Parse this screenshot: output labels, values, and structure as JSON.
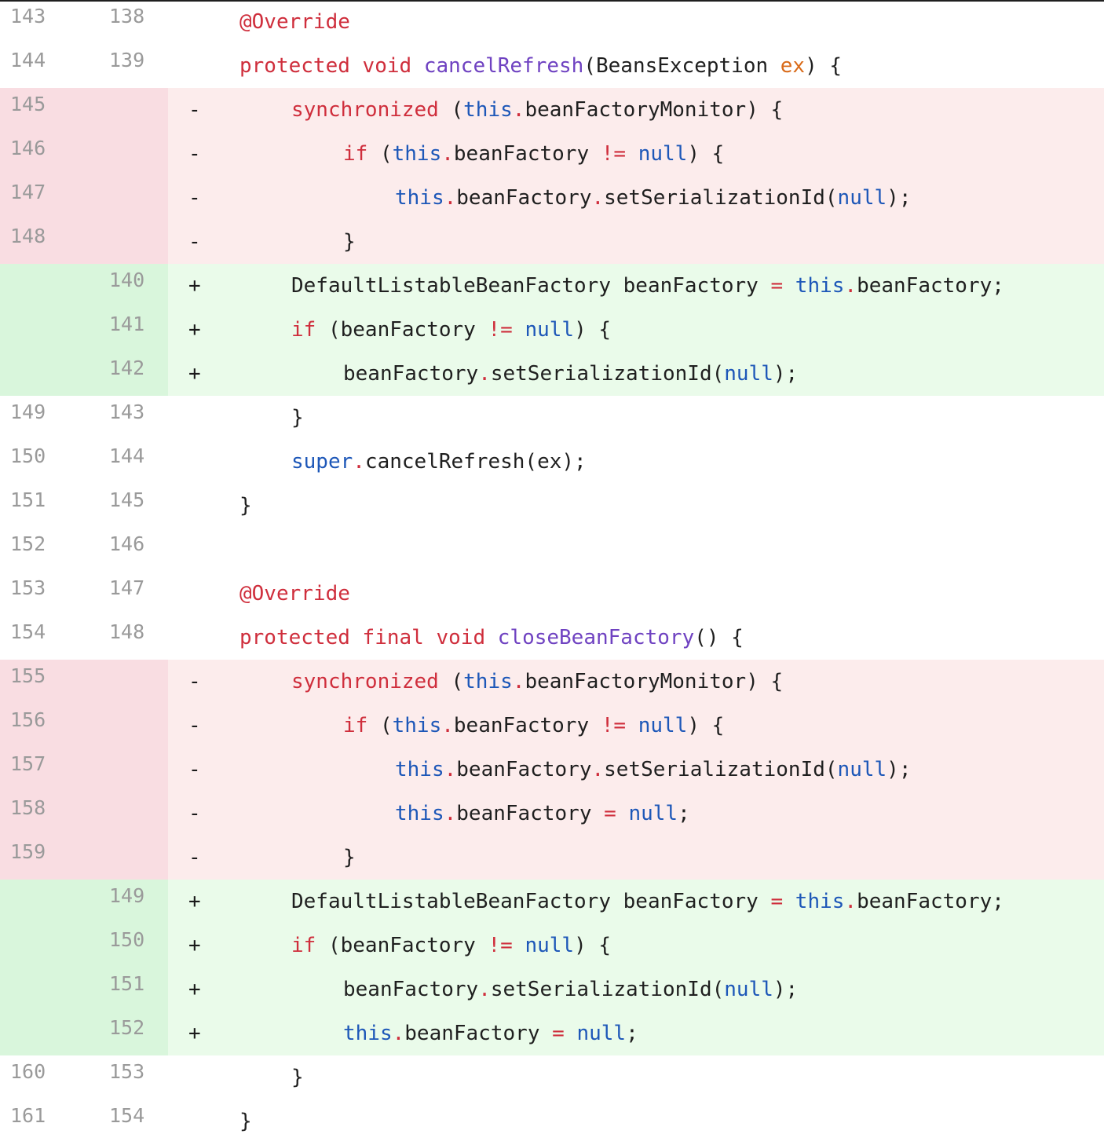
{
  "diff": {
    "lines": [
      {
        "type": "context",
        "old": "143",
        "new": "138",
        "marker": "",
        "indent": 1,
        "tokens": [
          {
            "t": "@Override",
            "c": "ann"
          }
        ]
      },
      {
        "type": "context",
        "old": "144",
        "new": "139",
        "marker": "",
        "indent": 1,
        "tokens": [
          {
            "t": "protected",
            "c": "kw"
          },
          {
            "t": " "
          },
          {
            "t": "void",
            "c": "kw"
          },
          {
            "t": " "
          },
          {
            "t": "cancelRefresh",
            "c": "fn"
          },
          {
            "t": "(BeansException "
          },
          {
            "t": "ex",
            "c": "par"
          },
          {
            "t": ") {"
          }
        ]
      },
      {
        "type": "removed",
        "old": "145",
        "new": "",
        "marker": "-",
        "indent": 2,
        "tokens": [
          {
            "t": "synchronized",
            "c": "kw"
          },
          {
            "t": " ("
          },
          {
            "t": "this",
            "c": "lit"
          },
          {
            "t": ".",
            "c": "op"
          },
          {
            "t": "beanFactoryMonitor) {"
          }
        ]
      },
      {
        "type": "removed",
        "old": "146",
        "new": "",
        "marker": "-",
        "indent": 3,
        "tokens": [
          {
            "t": "if",
            "c": "kw"
          },
          {
            "t": " ("
          },
          {
            "t": "this",
            "c": "lit"
          },
          {
            "t": ".",
            "c": "op"
          },
          {
            "t": "beanFactory "
          },
          {
            "t": "!=",
            "c": "op"
          },
          {
            "t": " "
          },
          {
            "t": "null",
            "c": "lit"
          },
          {
            "t": ") {"
          }
        ]
      },
      {
        "type": "removed",
        "old": "147",
        "new": "",
        "marker": "-",
        "indent": 4,
        "tokens": [
          {
            "t": "this",
            "c": "lit"
          },
          {
            "t": ".",
            "c": "op"
          },
          {
            "t": "beanFactory"
          },
          {
            "t": ".",
            "c": "op"
          },
          {
            "t": "setSerializationId("
          },
          {
            "t": "null",
            "c": "lit"
          },
          {
            "t": ");"
          }
        ]
      },
      {
        "type": "removed",
        "old": "148",
        "new": "",
        "marker": "-",
        "indent": 3,
        "tokens": [
          {
            "t": "}"
          }
        ]
      },
      {
        "type": "added",
        "old": "",
        "new": "140",
        "marker": "+",
        "indent": 2,
        "tokens": [
          {
            "t": "DefaultListableBeanFactory beanFactory "
          },
          {
            "t": "=",
            "c": "op"
          },
          {
            "t": " "
          },
          {
            "t": "this",
            "c": "lit"
          },
          {
            "t": ".",
            "c": "op"
          },
          {
            "t": "beanFactory;"
          }
        ]
      },
      {
        "type": "added",
        "old": "",
        "new": "141",
        "marker": "+",
        "indent": 2,
        "tokens": [
          {
            "t": "if",
            "c": "kw"
          },
          {
            "t": " (beanFactory "
          },
          {
            "t": "!=",
            "c": "op"
          },
          {
            "t": " "
          },
          {
            "t": "null",
            "c": "lit"
          },
          {
            "t": ") {"
          }
        ]
      },
      {
        "type": "added",
        "old": "",
        "new": "142",
        "marker": "+",
        "indent": 3,
        "tokens": [
          {
            "t": "beanFactory"
          },
          {
            "t": ".",
            "c": "op"
          },
          {
            "t": "setSerializationId("
          },
          {
            "t": "null",
            "c": "lit"
          },
          {
            "t": ");"
          }
        ]
      },
      {
        "type": "context",
        "old": "149",
        "new": "143",
        "marker": "",
        "indent": 2,
        "tokens": [
          {
            "t": "}"
          }
        ]
      },
      {
        "type": "context",
        "old": "150",
        "new": "144",
        "marker": "",
        "indent": 2,
        "tokens": [
          {
            "t": "super",
            "c": "lit"
          },
          {
            "t": ".",
            "c": "op"
          },
          {
            "t": "cancelRefresh(ex);"
          }
        ]
      },
      {
        "type": "context",
        "old": "151",
        "new": "145",
        "marker": "",
        "indent": 1,
        "tokens": [
          {
            "t": "}"
          }
        ]
      },
      {
        "type": "context",
        "old": "152",
        "new": "146",
        "marker": "",
        "indent": 1,
        "tokens": []
      },
      {
        "type": "context",
        "old": "153",
        "new": "147",
        "marker": "",
        "indent": 1,
        "tokens": [
          {
            "t": "@Override",
            "c": "ann"
          }
        ]
      },
      {
        "type": "context",
        "old": "154",
        "new": "148",
        "marker": "",
        "indent": 1,
        "tokens": [
          {
            "t": "protected",
            "c": "kw"
          },
          {
            "t": " "
          },
          {
            "t": "final",
            "c": "kw"
          },
          {
            "t": " "
          },
          {
            "t": "void",
            "c": "kw"
          },
          {
            "t": " "
          },
          {
            "t": "closeBeanFactory",
            "c": "fn"
          },
          {
            "t": "() {"
          }
        ]
      },
      {
        "type": "removed",
        "old": "155",
        "new": "",
        "marker": "-",
        "indent": 2,
        "tokens": [
          {
            "t": "synchronized",
            "c": "kw"
          },
          {
            "t": " ("
          },
          {
            "t": "this",
            "c": "lit"
          },
          {
            "t": ".",
            "c": "op"
          },
          {
            "t": "beanFactoryMonitor) {"
          }
        ]
      },
      {
        "type": "removed",
        "old": "156",
        "new": "",
        "marker": "-",
        "indent": 3,
        "tokens": [
          {
            "t": "if",
            "c": "kw"
          },
          {
            "t": " ("
          },
          {
            "t": "this",
            "c": "lit"
          },
          {
            "t": ".",
            "c": "op"
          },
          {
            "t": "beanFactory "
          },
          {
            "t": "!=",
            "c": "op"
          },
          {
            "t": " "
          },
          {
            "t": "null",
            "c": "lit"
          },
          {
            "t": ") {"
          }
        ]
      },
      {
        "type": "removed",
        "old": "157",
        "new": "",
        "marker": "-",
        "indent": 4,
        "tokens": [
          {
            "t": "this",
            "c": "lit"
          },
          {
            "t": ".",
            "c": "op"
          },
          {
            "t": "beanFactory"
          },
          {
            "t": ".",
            "c": "op"
          },
          {
            "t": "setSerializationId("
          },
          {
            "t": "null",
            "c": "lit"
          },
          {
            "t": ");"
          }
        ]
      },
      {
        "type": "removed",
        "old": "158",
        "new": "",
        "marker": "-",
        "indent": 4,
        "tokens": [
          {
            "t": "this",
            "c": "lit"
          },
          {
            "t": ".",
            "c": "op"
          },
          {
            "t": "beanFactory "
          },
          {
            "t": "=",
            "c": "op"
          },
          {
            "t": " "
          },
          {
            "t": "null",
            "c": "lit"
          },
          {
            "t": ";"
          }
        ]
      },
      {
        "type": "removed",
        "old": "159",
        "new": "",
        "marker": "-",
        "indent": 3,
        "tokens": [
          {
            "t": "}"
          }
        ]
      },
      {
        "type": "added",
        "old": "",
        "new": "149",
        "marker": "+",
        "indent": 2,
        "tokens": [
          {
            "t": "DefaultListableBeanFactory beanFactory "
          },
          {
            "t": "=",
            "c": "op"
          },
          {
            "t": " "
          },
          {
            "t": "this",
            "c": "lit"
          },
          {
            "t": ".",
            "c": "op"
          },
          {
            "t": "beanFactory;"
          }
        ]
      },
      {
        "type": "added",
        "old": "",
        "new": "150",
        "marker": "+",
        "indent": 2,
        "tokens": [
          {
            "t": "if",
            "c": "kw"
          },
          {
            "t": " (beanFactory "
          },
          {
            "t": "!=",
            "c": "op"
          },
          {
            "t": " "
          },
          {
            "t": "null",
            "c": "lit"
          },
          {
            "t": ") {"
          }
        ]
      },
      {
        "type": "added",
        "old": "",
        "new": "151",
        "marker": "+",
        "indent": 3,
        "tokens": [
          {
            "t": "beanFactory"
          },
          {
            "t": ".",
            "c": "op"
          },
          {
            "t": "setSerializationId("
          },
          {
            "t": "null",
            "c": "lit"
          },
          {
            "t": ");"
          }
        ]
      },
      {
        "type": "added",
        "old": "",
        "new": "152",
        "marker": "+",
        "indent": 3,
        "tokens": [
          {
            "t": "this",
            "c": "lit"
          },
          {
            "t": ".",
            "c": "op"
          },
          {
            "t": "beanFactory "
          },
          {
            "t": "=",
            "c": "op"
          },
          {
            "t": " "
          },
          {
            "t": "null",
            "c": "lit"
          },
          {
            "t": ";"
          }
        ]
      },
      {
        "type": "context",
        "old": "160",
        "new": "153",
        "marker": "",
        "indent": 2,
        "tokens": [
          {
            "t": "}"
          }
        ]
      },
      {
        "type": "context",
        "old": "161",
        "new": "154",
        "marker": "",
        "indent": 1,
        "tokens": [
          {
            "t": "}"
          }
        ]
      }
    ]
  },
  "colors": {
    "removed_bg": "#fcecec",
    "removed_gutter": "#f9dde2",
    "added_bg": "#eafbea",
    "added_gutter": "#d9f6dc",
    "keyword": "#cf2e3c",
    "literal": "#1d57b8",
    "function": "#6f42c1",
    "parameter": "#d96b1a"
  }
}
